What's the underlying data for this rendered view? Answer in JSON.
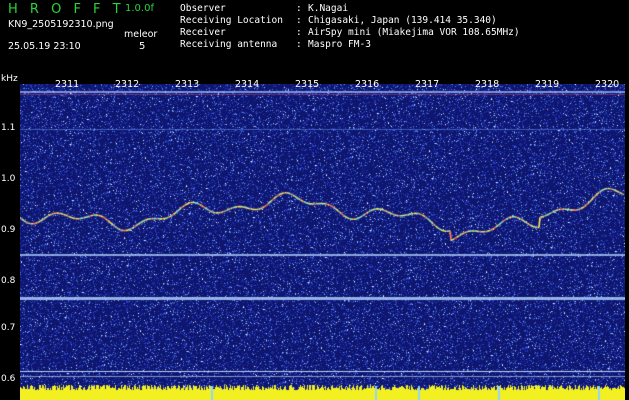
{
  "app": {
    "title": "H R O F F T",
    "version": "1.0.0f"
  },
  "file": {
    "name": "KN9_2505192310.png",
    "datetime": "25.05.19 23:10"
  },
  "mode": {
    "label": "meleor",
    "count": "5"
  },
  "info": [
    {
      "key": "Observer",
      "value": "K.Nagai"
    },
    {
      "key": "Receiving Location",
      "value": "Chigasaki, Japan (139.414 35.340)"
    },
    {
      "key": "Receiver",
      "value": "AirSpy mini (Miakejima VOR 108.65MHz)"
    },
    {
      "key": "Receiving antenna",
      "value": "Maspro FM-3"
    }
  ],
  "colon": ":",
  "y_axis": {
    "unit": "kHz",
    "ticks": [
      "1.1",
      "1.0",
      "0.9",
      "0.8",
      "0.7",
      "0.6"
    ]
  },
  "x_axis": {
    "ticks": [
      "2311",
      "2312",
      "2313",
      "2314",
      "2315",
      "2316",
      "2317",
      "2318",
      "2319",
      "2320"
    ]
  },
  "colors": {
    "title_green": "#29d33a",
    "noise_blue": "#1b2aa0",
    "trace": "#ffe95a",
    "bottom_bar": "#f3f021",
    "line_cyan": "#8fd6ff"
  }
}
